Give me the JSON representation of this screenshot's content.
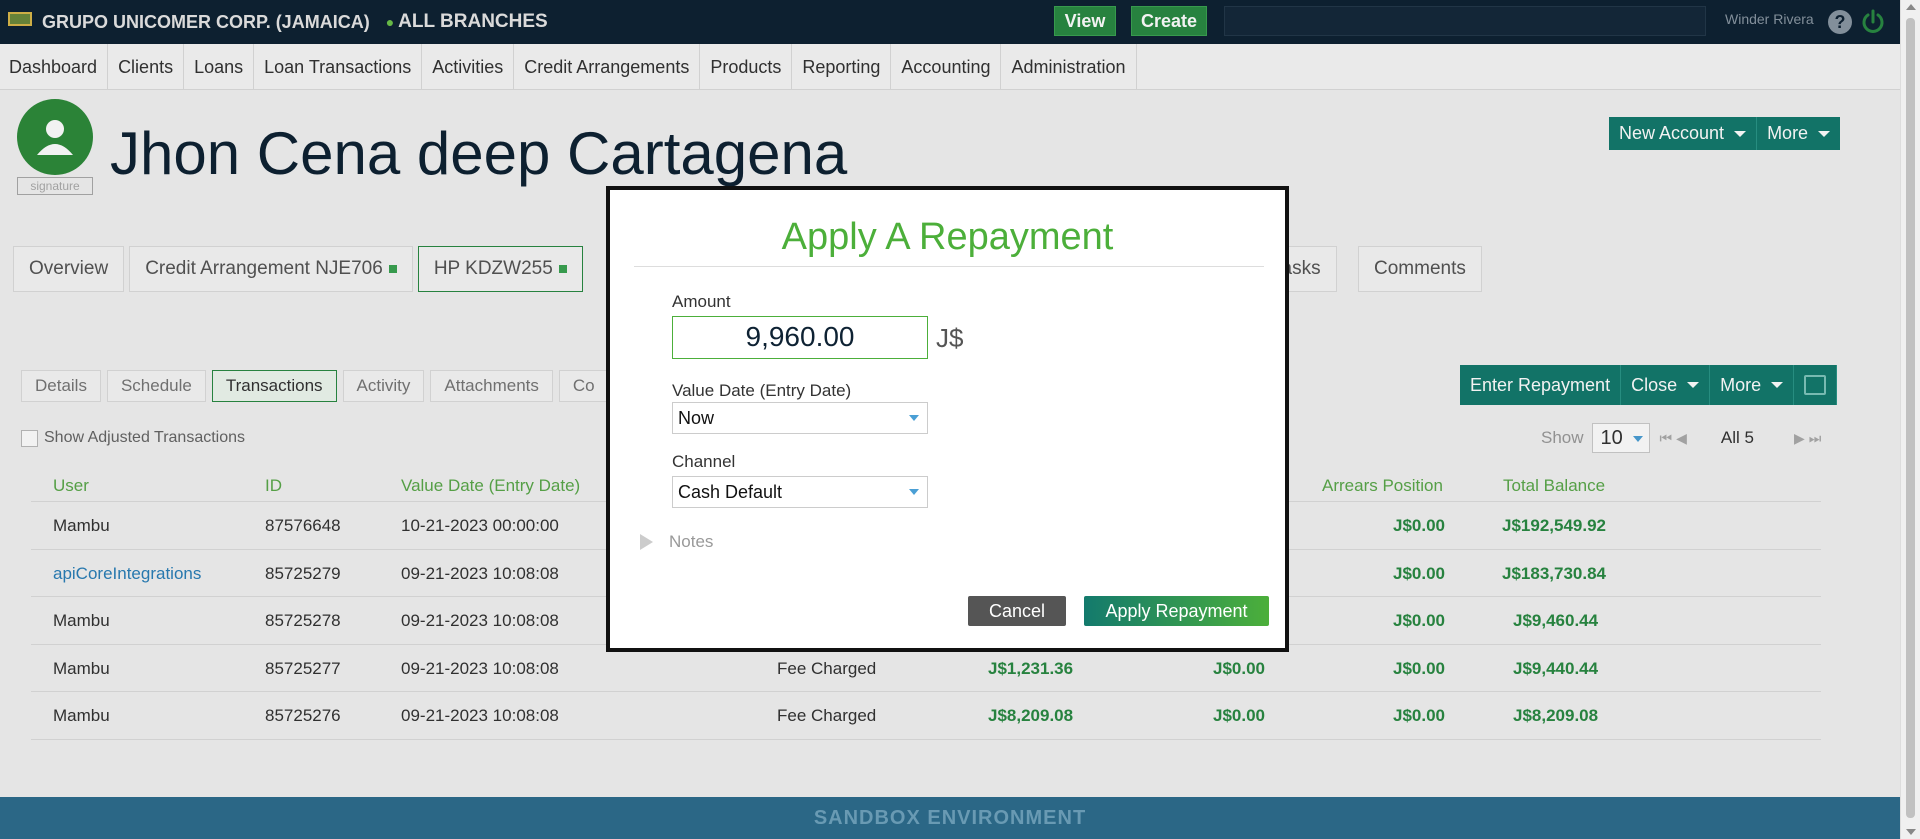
{
  "topbar": {
    "brand": "GRUPO UNICOMER CORP. (JAMAICA)",
    "branch": "ALL BRANCHES",
    "view_label": "View",
    "create_label": "Create",
    "search_value": "",
    "username": "Winder Rivera",
    "help_glyph": "?"
  },
  "nav": {
    "items": [
      "Dashboard",
      "Clients",
      "Loans",
      "Loan Transactions",
      "Activities",
      "Credit Arrangements",
      "Products",
      "Reporting",
      "Accounting",
      "Administration"
    ]
  },
  "client": {
    "name": "Jhon Cena deep Cartagena",
    "signature_label": "signature",
    "new_account_label": "New Account",
    "more_label": "More"
  },
  "account_tabs": {
    "overview": "Overview",
    "credit_arrangement": "Credit Arrangement NJE706",
    "loan": "HP KDZW255",
    "tasks": "Tasks",
    "comments": "Comments"
  },
  "sub_tabs": [
    "Details",
    "Schedule",
    "Transactions",
    "Activity",
    "Attachments",
    "Co"
  ],
  "account_actions": {
    "enter_repayment": "Enter Repayment",
    "close": "Close",
    "more": "More"
  },
  "filters": {
    "show_adjusted": "Show Adjusted Transactions",
    "show_label": "Show",
    "page_size": "10",
    "all_label": "All 5"
  },
  "table": {
    "headers": {
      "user": "User",
      "id": "ID",
      "value_date": "Value Date (Entry Date)",
      "arrears": "Arrears Position",
      "total": "Total Balance"
    },
    "rows": [
      {
        "user": "Mambu",
        "id": "87576648",
        "date": "10-21-2023 00:00:00",
        "type": "",
        "amount": "",
        "col2": "",
        "arrears": "J$0.00",
        "total": "J$192,549.92"
      },
      {
        "user": "apiCoreIntegrations",
        "id": "85725279",
        "date": "09-21-2023 10:08:08",
        "type": "",
        "amount": "",
        "col2": "",
        "arrears": "J$0.00",
        "total": "J$183,730.84"
      },
      {
        "user": "Mambu",
        "id": "85725278",
        "date": "09-21-2023 10:08:08",
        "type": "",
        "amount": "",
        "col2": "",
        "arrears": "J$0.00",
        "total": "J$9,460.44"
      },
      {
        "user": "Mambu",
        "id": "85725277",
        "date": "09-21-2023 10:08:08",
        "type": "Fee Charged",
        "amount": "J$1,231.36",
        "col2": "J$0.00",
        "arrears": "J$0.00",
        "total": "J$9,440.44"
      },
      {
        "user": "Mambu",
        "id": "85725276",
        "date": "09-21-2023 10:08:08",
        "type": "Fee Charged",
        "amount": "J$8,209.08",
        "col2": "J$0.00",
        "arrears": "J$0.00",
        "total": "J$8,209.08"
      }
    ]
  },
  "footer": {
    "sandbox": "SANDBOX ENVIRONMENT"
  },
  "modal": {
    "title": "Apply A Repayment",
    "amount_label": "Amount",
    "amount_value": "9,960.00",
    "currency": "J$",
    "value_date_label": "Value Date (Entry Date)",
    "value_date_value": "Now",
    "channel_label": "Channel",
    "channel_value": "Cash Default",
    "notes_label": "Notes",
    "cancel_label": "Cancel",
    "apply_label": "Apply Repayment"
  },
  "colors": {
    "topbar": "#0e2233",
    "accent_green": "#4caf3a",
    "teal": "#137a6d",
    "money_green": "#2a8a43"
  }
}
